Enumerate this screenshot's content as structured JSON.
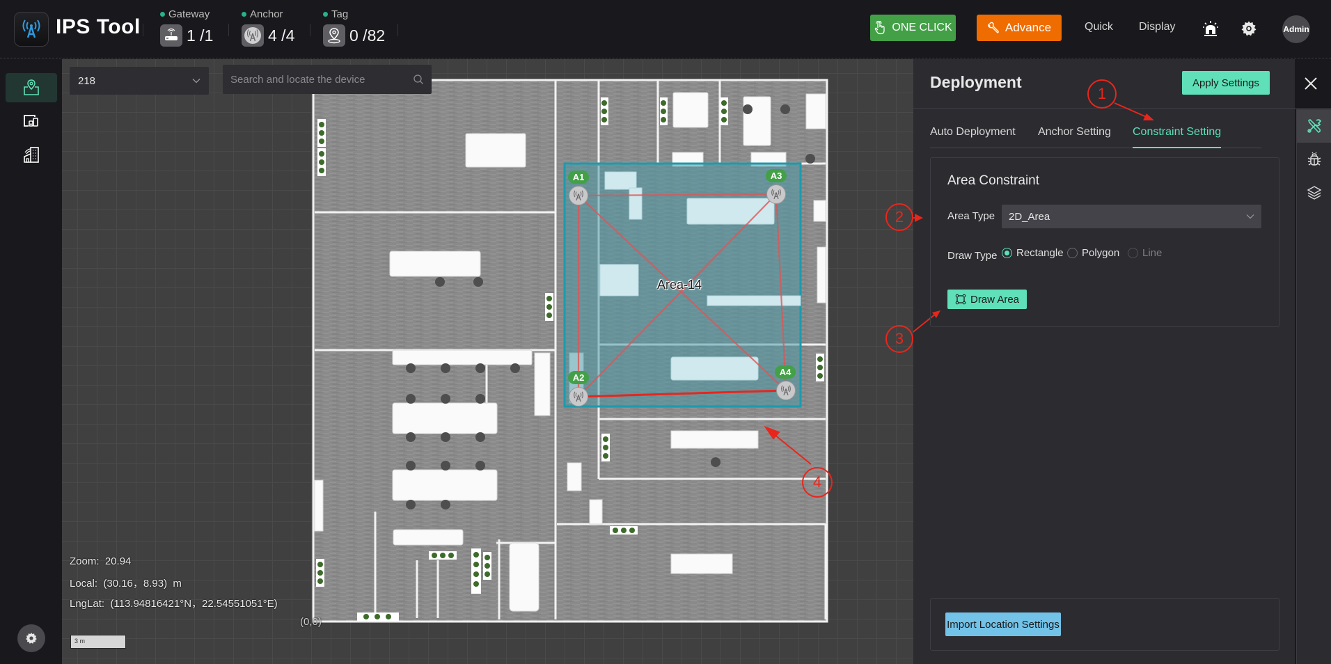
{
  "header": {
    "app_title": "IPS Tool",
    "logo_icon": "antenna-icon",
    "stats": [
      {
        "label": "Gateway",
        "value": "1 /1",
        "icon": "router-icon"
      },
      {
        "label": "Anchor",
        "value": "4 /4",
        "icon": "anchor-icon"
      },
      {
        "label": "Tag",
        "value": "0 /82",
        "icon": "tag-pin-icon"
      }
    ],
    "one_click_label": "ONE CLICK",
    "advance_label": "Advance",
    "quick_label": "Quick",
    "display_label": "Display",
    "avatar_label": "Admin",
    "status_color": "#27b38b",
    "one_click_color": "#43a047",
    "advance_color": "#ef6c00"
  },
  "sidebar": {
    "items": [
      {
        "name": "map-location",
        "icon": "map-pin-icon",
        "active": true
      },
      {
        "name": "devices",
        "icon": "devices-icon",
        "active": false
      },
      {
        "name": "buildings",
        "icon": "building-icon",
        "active": false
      }
    ],
    "settings_icon": "gear-icon"
  },
  "map": {
    "floor_value": "218",
    "search_placeholder": "Search and locate the device",
    "area_name": "Area-14",
    "anchors": [
      {
        "id": "A1"
      },
      {
        "id": "A2"
      },
      {
        "id": "A3"
      },
      {
        "id": "A4"
      }
    ],
    "readout": {
      "zoom": "Zoom:  20.94",
      "local": "Local:  (30.16，8.93)  m",
      "lnglat": "LngLat:  (113.94816421°N，22.54551051°E)"
    },
    "origin_label": "(0,0)",
    "scale_label": "3 m"
  },
  "annotations": [
    "1",
    "2",
    "3",
    "4"
  ],
  "panel": {
    "title": "Deployment",
    "apply_label": "Apply Settings",
    "tabs": [
      {
        "label": "Auto Deployment",
        "active": false
      },
      {
        "label": "Anchor Setting",
        "active": false
      },
      {
        "label": "Constraint Setting",
        "active": true
      }
    ],
    "card_title": "Area Constraint",
    "area_type_label": "Area Type",
    "area_type_value": "2D_Area",
    "draw_type_label": "Draw Type",
    "draw_options": [
      {
        "label": "Rectangle",
        "selected": true,
        "disabled": false
      },
      {
        "label": "Polygon",
        "selected": false,
        "disabled": false
      },
      {
        "label": "Line",
        "selected": false,
        "disabled": true
      }
    ],
    "draw_area_label": "Draw Area",
    "import_label": "Import Location Settings",
    "accent_color": "#5fe0b8"
  },
  "right_strip": {
    "items": [
      {
        "icon": "tools-icon",
        "active": true
      },
      {
        "icon": "bug-icon",
        "active": false
      },
      {
        "icon": "layers-icon",
        "active": false
      }
    ]
  }
}
